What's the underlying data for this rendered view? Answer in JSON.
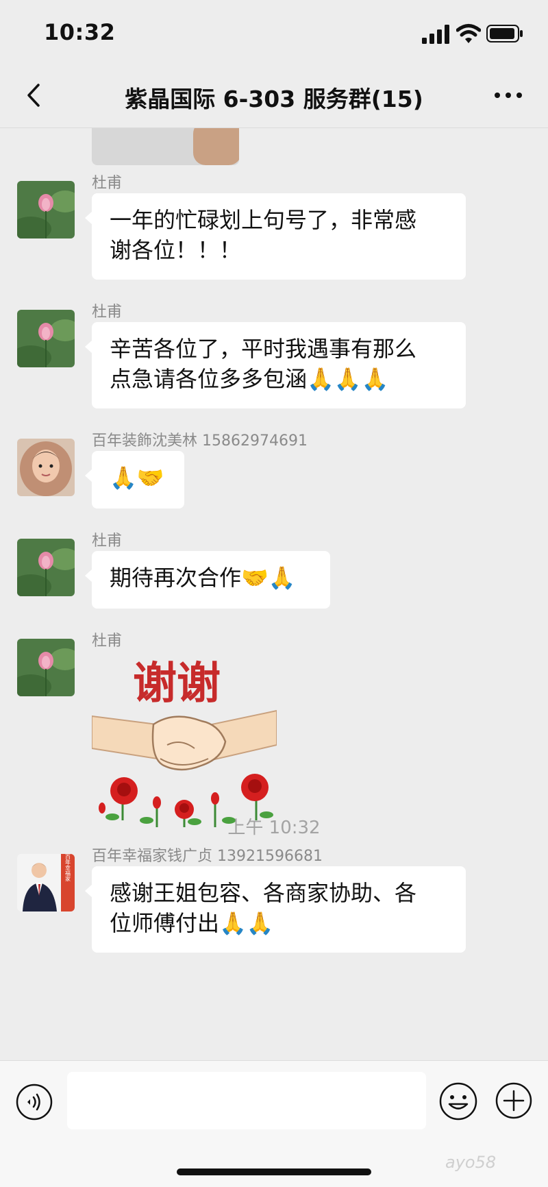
{
  "status_bar": {
    "time": "10:32"
  },
  "header": {
    "title": "紫晶国际 6-303 服务群(15)"
  },
  "messages": [
    {
      "sender": "杜甫",
      "line1": "一年的忙碌划上句号了，非常感",
      "line2": "谢各位！！！"
    },
    {
      "sender": "杜甫",
      "line1": "辛苦各位了，平时我遇事有那么",
      "line2": "点急请各位多多包涵🙏🙏🙏"
    },
    {
      "sender": "百年装飾沈美林 15862974691",
      "text": "🙏🤝"
    },
    {
      "sender": "杜甫",
      "text": "期待再次合作🤝🙏"
    },
    {
      "sender": "杜甫",
      "sticker_text": "谢谢"
    },
    {
      "sender": "百年幸福家钱广贞 13921596681",
      "line1": "感谢王姐包容、各商家协助、各",
      "line2": "位师傅付出🙏🙏"
    }
  ],
  "timestamp": "上午 10:32",
  "avatar_logo_text": "百年幸福家",
  "watermark": "ayo58"
}
